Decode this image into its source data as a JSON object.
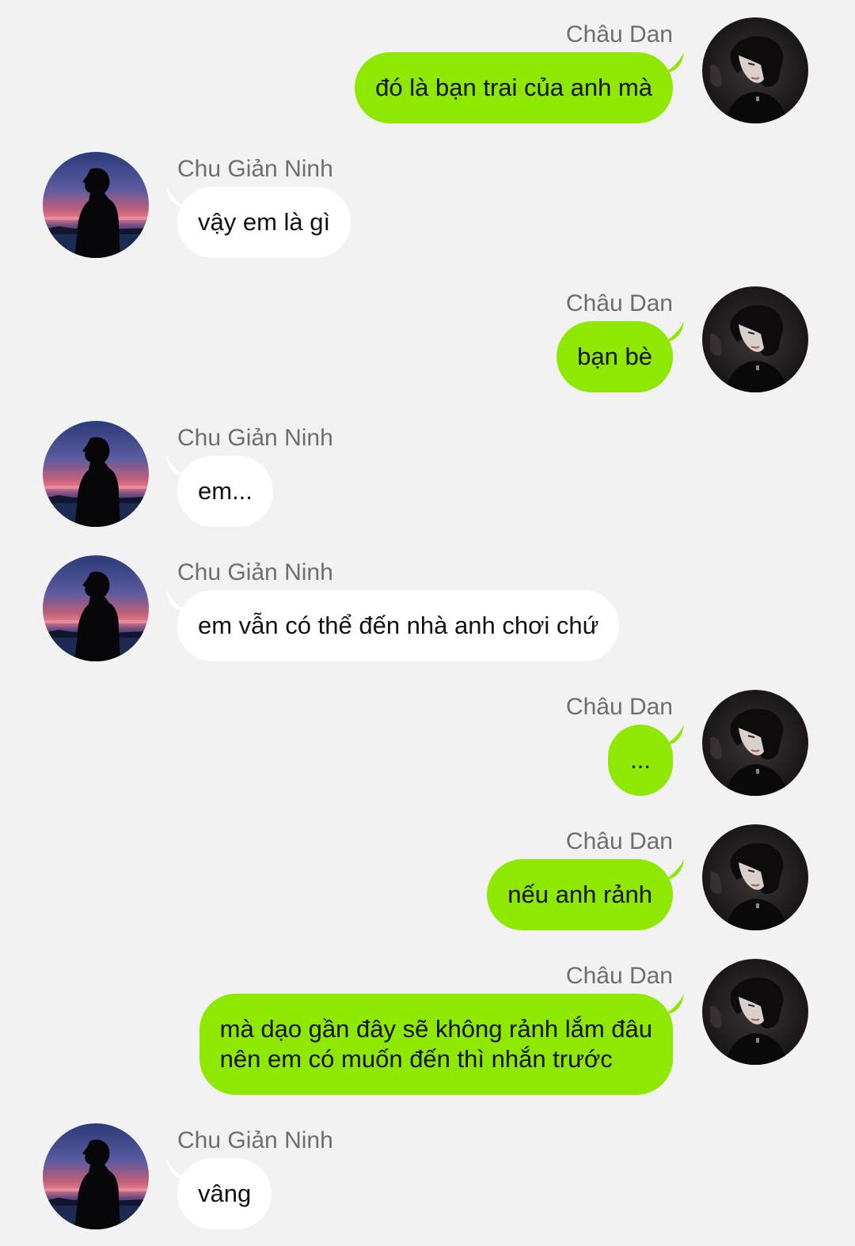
{
  "colors": {
    "background": "#f2f2f2",
    "sent_bubble": "#8ee800",
    "received_bubble": "#ffffff",
    "name_text": "#6e6e6e"
  },
  "users": {
    "chau_dan": {
      "name": "Châu Dan",
      "avatar_icon": "dark-portrait-avatar"
    },
    "chu_gian_ninh": {
      "name": "Chu Giản Ninh",
      "avatar_icon": "sunset-silhouette-avatar"
    }
  },
  "messages": [
    {
      "sender": "Châu Dan",
      "side": "right",
      "lines": [
        "đó là bạn trai của anh mà"
      ]
    },
    {
      "sender": "Chu Giản Ninh",
      "side": "left",
      "lines": [
        "vậy em là gì"
      ]
    },
    {
      "sender": "Châu Dan",
      "side": "right",
      "lines": [
        "bạn bè"
      ]
    },
    {
      "sender": "Chu Giản Ninh",
      "side": "left",
      "lines": [
        "em..."
      ]
    },
    {
      "sender": "Chu Giản Ninh",
      "side": "left",
      "lines": [
        "em vẫn có thể đến nhà anh chơi chứ"
      ]
    },
    {
      "sender": "Châu Dan",
      "side": "right",
      "lines": [
        "..."
      ]
    },
    {
      "sender": "Châu Dan",
      "side": "right",
      "lines": [
        "nếu anh rảnh"
      ]
    },
    {
      "sender": "Châu Dan",
      "side": "right",
      "lines": [
        "mà dạo gần đây sẽ không rảnh lắm đâu",
        "nên em có muốn đến thì nhắn trước"
      ]
    },
    {
      "sender": "Chu Giản Ninh",
      "side": "left",
      "lines": [
        "vâng"
      ]
    }
  ]
}
